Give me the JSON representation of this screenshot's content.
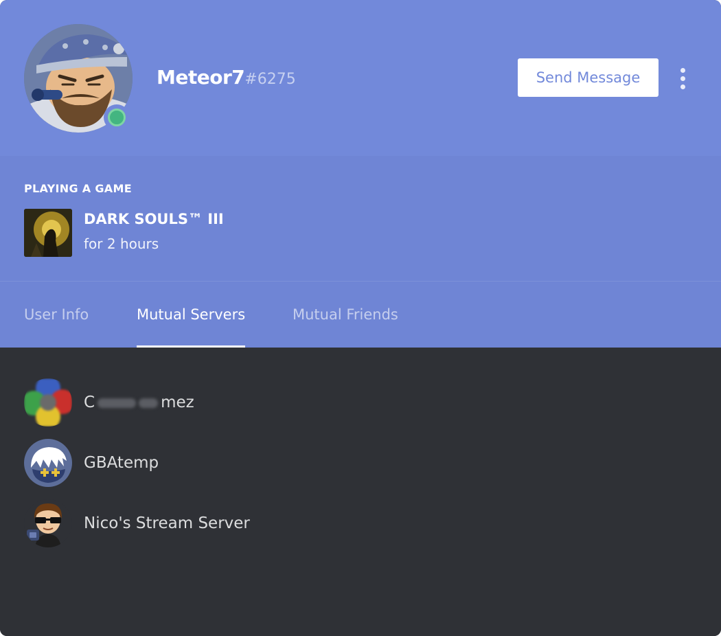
{
  "profile": {
    "username": "Meteor7",
    "discriminator": "#6275",
    "status": "online",
    "send_message_label": "Send Message"
  },
  "activity": {
    "label": "PLAYING A GAME",
    "game_name": "DARK SOULS™ III",
    "duration": "for 2 hours"
  },
  "tabs": [
    {
      "label": "User Info",
      "active": false
    },
    {
      "label": "Mutual Servers",
      "active": true
    },
    {
      "label": "Mutual Friends",
      "active": false
    }
  ],
  "mutual_servers": [
    {
      "name_start": "C",
      "name_end": "mez",
      "name_obscured": true
    },
    {
      "name": "GBAtemp"
    },
    {
      "name": "Nico's Stream Server"
    }
  ],
  "colors": {
    "blurple": "#7289da",
    "panel_bg": "#2f3136",
    "online": "#43b581"
  }
}
